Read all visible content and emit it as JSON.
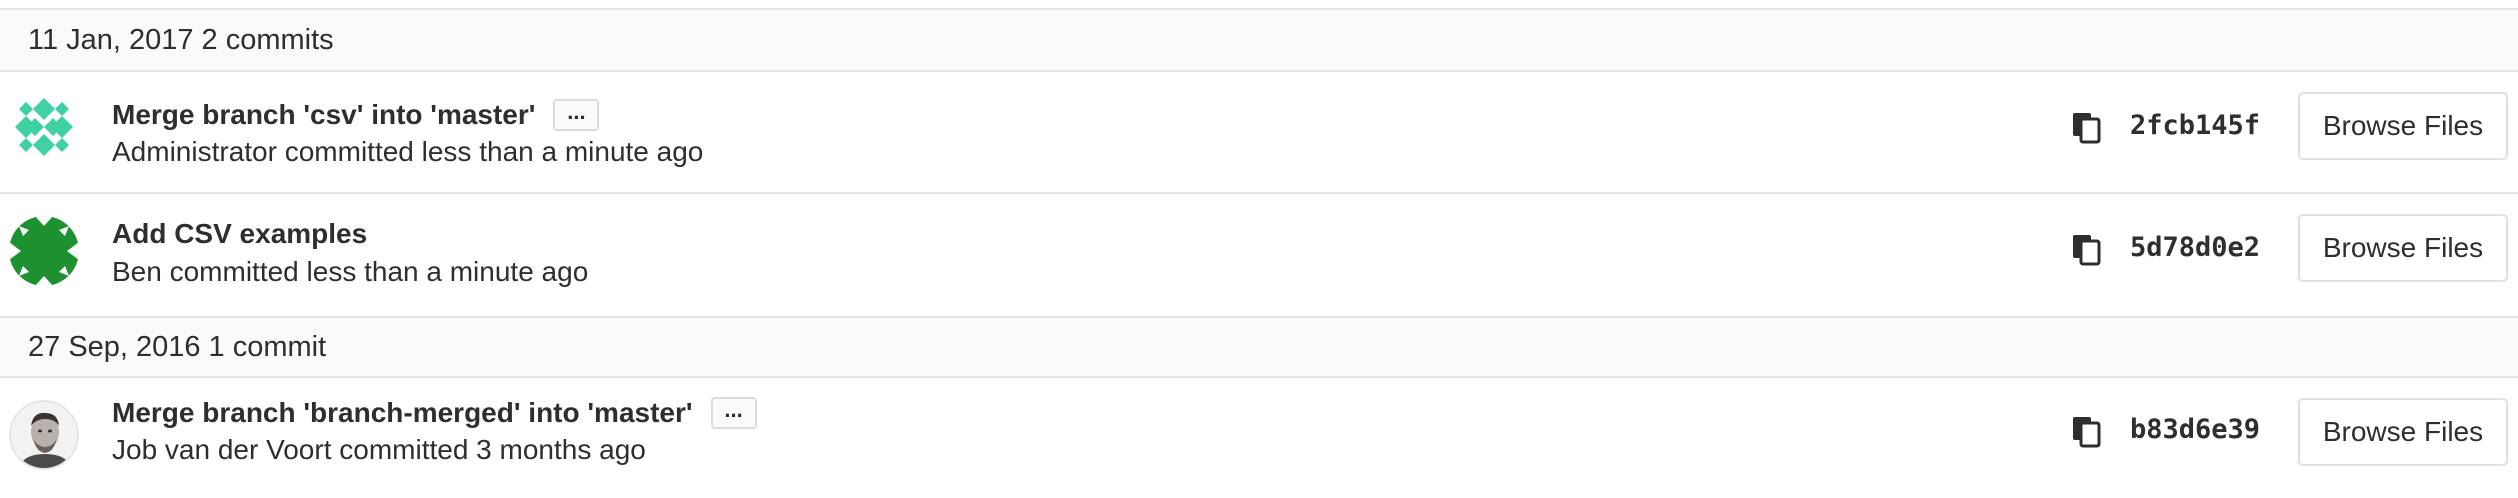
{
  "days": [
    {
      "date": "11 Jan, 2017",
      "count": "2 commits",
      "commits": [
        {
          "title": "Merge branch 'csv' into 'master'",
          "has_ellipsis": true,
          "ellipsis_label": "...",
          "meta": "Administrator committed less than a minute ago",
          "sha": "2fcb145f",
          "browse_label": "Browse Files",
          "avatar": "identicon-teal"
        },
        {
          "title": "Add CSV examples",
          "has_ellipsis": false,
          "meta": "Ben committed less than a minute ago",
          "sha": "5d78d0e2",
          "browse_label": "Browse Files",
          "avatar": "identicon-green"
        }
      ]
    },
    {
      "date": "27 Sep, 2016",
      "count": "1 commit",
      "commits": [
        {
          "title": "Merge branch 'branch-merged' into 'master'",
          "has_ellipsis": true,
          "ellipsis_label": "...",
          "meta": "Job van der Voort committed 3 months ago",
          "sha": "b83d6e39",
          "browse_label": "Browse Files",
          "avatar": "photo-person"
        }
      ]
    }
  ],
  "icons": {
    "copy": "copy-icon",
    "ellipsis": "ellipsis-icon"
  },
  "colors": {
    "identicon_teal": "#3fd0a4",
    "identicon_green": "#1d9130",
    "header_bg": "#fafafa",
    "border": "#e5e5e5",
    "text": "#2e2e2e"
  }
}
